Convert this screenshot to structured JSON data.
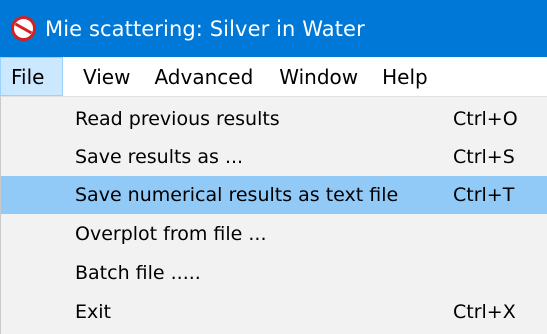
{
  "window": {
    "title": "Mie scattering:  Silver in Water",
    "icon": "no-entry-circle-icon",
    "titlebar_color": "#0078d7"
  },
  "menubar": {
    "items": [
      {
        "label": "File",
        "active": true
      },
      {
        "label": "View"
      },
      {
        "label": "Advanced"
      },
      {
        "label": "Window"
      },
      {
        "label": "Help"
      }
    ]
  },
  "file_menu": {
    "items": [
      {
        "label": "Read previous results",
        "shortcut": "Ctrl+O"
      },
      {
        "label": "Save results as ...",
        "shortcut": "Ctrl+S"
      },
      {
        "label": "Save numerical results as text file",
        "shortcut": "Ctrl+T",
        "highlighted": true
      },
      {
        "label": "Overplot from file ...",
        "shortcut": ""
      },
      {
        "label": "Batch file .....",
        "shortcut": ""
      },
      {
        "label": "Exit",
        "shortcut": "Ctrl+X"
      }
    ],
    "highlight_color": "#91c9f7"
  }
}
